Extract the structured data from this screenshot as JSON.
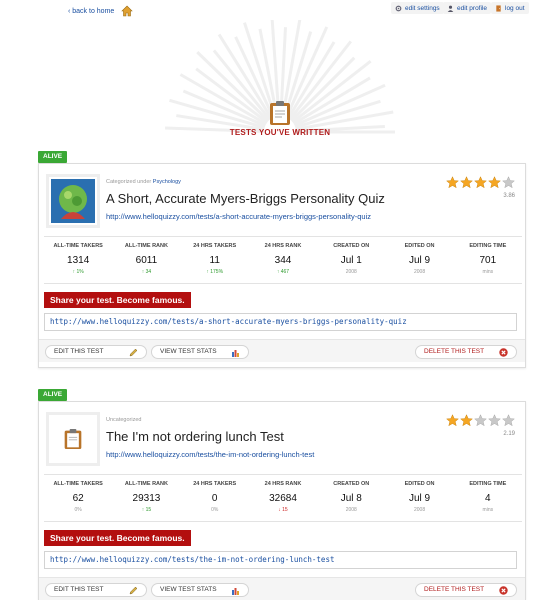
{
  "nav": {
    "back_label": "‹ back to home",
    "edit_settings": "edit settings",
    "edit_profile": "edit profile",
    "log_out": "log out"
  },
  "hero": {
    "title": "TESTS YOU'VE WRITTEN"
  },
  "colors": {
    "accent_red": "#b30f0f",
    "badge_green": "#3aa835",
    "link_blue": "#1a4fa0",
    "star_gold": "#f5a623"
  },
  "stat_labels": [
    "ALL-TIME TAKERS",
    "ALL-TIME RANK",
    "24 HRS TAKERS",
    "24 HRS RANK",
    "CREATED ON",
    "EDITED ON",
    "EDITING TIME"
  ],
  "share_label": "Share your test. Become famous.",
  "buttons": {
    "edit": "EDIT THIS TEST",
    "stats": "VIEW TEST STATS",
    "delete": "DELETE THIS TEST"
  },
  "tests": [
    {
      "badge": "ALIVE",
      "category_prefix": "Categorized under",
      "category": "Psychology",
      "title": "A Short, Accurate Myers-Briggs Personality Quiz",
      "url": "http://www.helloquizzy.com/tests/a-short-accurate-myers-briggs-personality-quiz",
      "share_url": "http://www.helloquizzy.com/tests/a-short-accurate-myers-briggs-personality-quiz",
      "rating": "3.86",
      "stars": 4,
      "thumb_icon": "globe-brain-icon",
      "stats": [
        {
          "value": "1314",
          "sub": "↑ 1%",
          "trend": "up"
        },
        {
          "value": "6011",
          "sub": "↑ 34",
          "trend": "up"
        },
        {
          "value": "11",
          "sub": "↑ 175%",
          "trend": "up"
        },
        {
          "value": "344",
          "sub": "↑ 467",
          "trend": "up"
        },
        {
          "value": "Jul 1",
          "sub": "2008",
          "trend": "none"
        },
        {
          "value": "Jul 9",
          "sub": "2008",
          "trend": "none"
        },
        {
          "value": "701",
          "sub": "mins",
          "trend": "none"
        }
      ]
    },
    {
      "badge": "ALIVE",
      "category_prefix": "Uncategorized",
      "category": "",
      "title": "The I'm not ordering lunch Test",
      "url": "http://www.helloquizzy.com/tests/the-im-not-ordering-lunch-test",
      "share_url": "http://www.helloquizzy.com/tests/the-im-not-ordering-lunch-test",
      "rating": "2.19",
      "stars": 2,
      "thumb_icon": "clipboard-icon",
      "stats": [
        {
          "value": "62",
          "sub": "0%",
          "trend": "none"
        },
        {
          "value": "29313",
          "sub": "↑ 15",
          "trend": "up"
        },
        {
          "value": "0",
          "sub": "0%",
          "trend": "none"
        },
        {
          "value": "32684",
          "sub": "↓ 15",
          "trend": "down"
        },
        {
          "value": "Jul 8",
          "sub": "2008",
          "trend": "none"
        },
        {
          "value": "Jul 9",
          "sub": "2008",
          "trend": "none"
        },
        {
          "value": "4",
          "sub": "mins",
          "trend": "none"
        }
      ]
    }
  ]
}
